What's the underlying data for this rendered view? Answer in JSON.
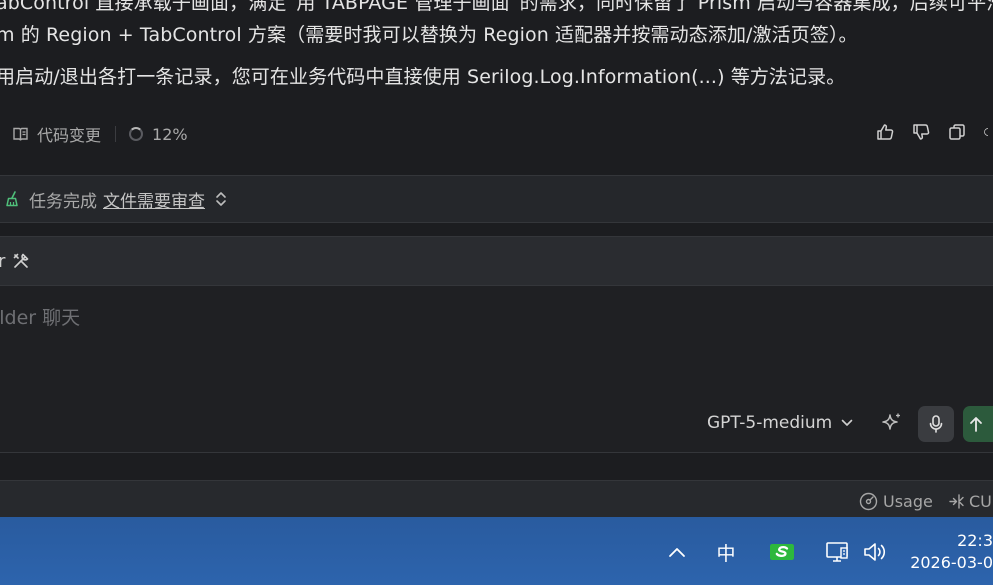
{
  "message": {
    "line1": "abControl 直接承载子画面，满足“用 TABPAGE 管理子画面”的需求，同时保留了 Prism 启动与容器集成，后续可平滑",
    "line2": "m 的 Region + TabControl 方案（需要时我可以替换为 Region 适配器并按需动态添加/激活页签）。",
    "line3": "用启动/退出各打一条记录，您可在业务代码中直接使用 Serilog.Log.Information(...) 等方法记录。"
  },
  "actions": {
    "changes_label": "代码变更",
    "progress_label": "12%",
    "progress_value": 12
  },
  "task": {
    "status": "任务完成",
    "review_link": "文件需要审查"
  },
  "composer": {
    "header_label": "r",
    "placeholder": "ilder 聊天",
    "model": "GPT-5-medium"
  },
  "statusbar": {
    "usage": "Usage",
    "cu": "CU"
  },
  "taskbar": {
    "ime": "中",
    "time": "22:3",
    "date": "2026-03-0"
  },
  "colors": {
    "send_button": "#2c5a3c",
    "taskbar": "#2d64ad",
    "sogou": "#2db83d"
  }
}
